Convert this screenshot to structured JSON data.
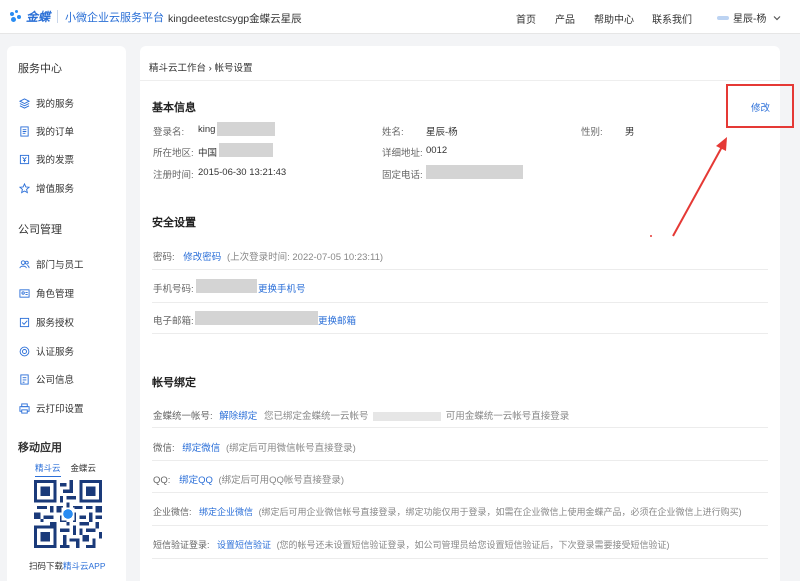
{
  "header": {
    "logo_text": "金蝶",
    "platform": "小微企业云服务平台",
    "company": "kingdeetestcsygp金蝶云星辰",
    "nav": [
      "首页",
      "产品",
      "帮助中心",
      "联系我们"
    ],
    "user_name": "星辰-杨"
  },
  "sidebar": {
    "service_center": "服务中心",
    "service_items": [
      "我的服务",
      "我的订单",
      "我的发票",
      "增值服务"
    ],
    "company_mgmt": "公司管理",
    "company_items": [
      "部门与员工",
      "角色管理",
      "服务授权",
      "认证服务",
      "公司信息",
      "云打印设置"
    ],
    "mobile_app": "移动应用",
    "app_tabs": [
      "精斗云",
      "金蝶云"
    ],
    "qr_caption_prefix": "扫码下载",
    "qr_caption_link": "精斗云APP"
  },
  "main": {
    "breadcrumb": "精斗云工作台 › 帐号设置",
    "basic_info": {
      "title": "基本信息",
      "edit": "修改",
      "login_label": "登录名:",
      "login_value": "king",
      "name_label": "姓名:",
      "name_value": "星辰-杨",
      "gender_label": "性别:",
      "gender_value": "男",
      "region_label": "所在地区:",
      "region_value": "中国",
      "address_label": "详细地址:",
      "address_value": "0012",
      "reg_label": "注册时间:",
      "reg_value": "2015-06-30 13:21:43",
      "phone_label": "固定电话:"
    },
    "security": {
      "title": "安全设置",
      "password_label": "密码:",
      "password_link": "修改密码",
      "password_note": "(上次登录时间: 2022-07-05 10:23:11)",
      "mobile_label": "手机号码:",
      "mobile_link": "更换手机号",
      "email_label": "电子邮箱:",
      "email_link": "更换邮箱"
    },
    "binding": {
      "title": "帐号绑定",
      "unified_label": "金蝶统一帐号:",
      "unified_link": "解除绑定",
      "unified_note_a": "您已绑定金蝶统一云帐号",
      "unified_note_b": "可用金蝶统一云帐号直接登录",
      "wechat_label": "微信:",
      "wechat_link": "绑定微信",
      "wechat_note": "(绑定后可用微信帐号直接登录)",
      "qq_label": "QQ:",
      "qq_link": "绑定QQ",
      "qq_note": "(绑定后可用QQ帐号直接登录)",
      "work_wechat_label": "企业微信:",
      "work_wechat_link": "绑定企业微信",
      "work_wechat_note": "(绑定后可用企业微信帐号直接登录，绑定功能仅用于登录，如需在企业微信上使用金蝶产品，必须在企业微信上进行购买)",
      "sms_label": "短信验证登录:",
      "sms_link": "设置短信验证",
      "sms_note": "(您的帐号还未设置短信验证登录，如公司管理员给您设置短信验证后，下次登录需要接受短信验证)"
    }
  },
  "colors": {
    "accent": "#2b6fd8",
    "annotation": "#e53935"
  }
}
